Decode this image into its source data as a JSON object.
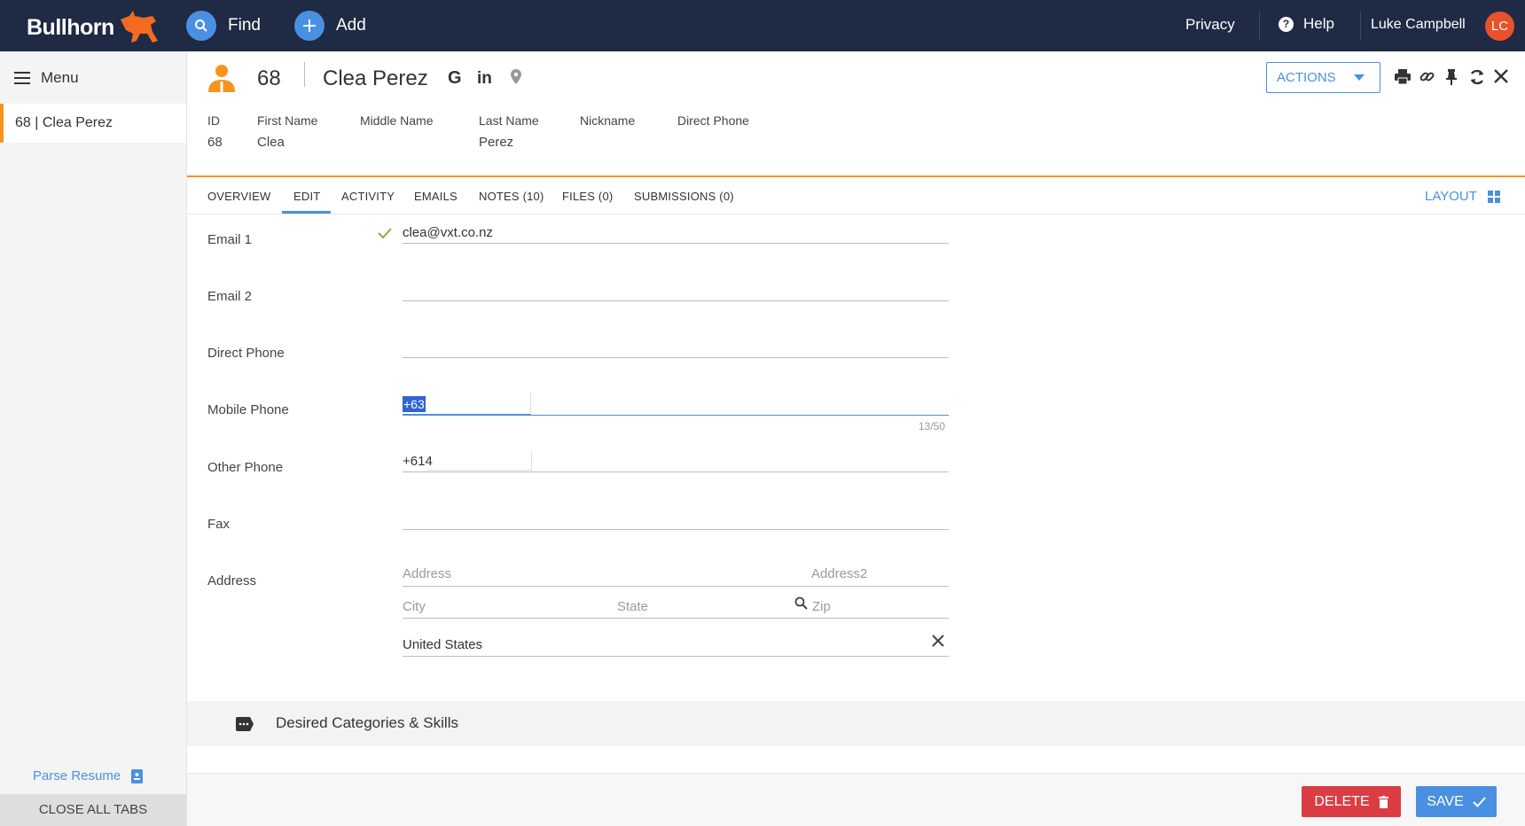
{
  "topbar": {
    "logo": "Bullhorn",
    "find_label": "Find",
    "add_label": "Add",
    "privacy_label": "Privacy",
    "help_label": "Help",
    "user_name": "Luke Campbell",
    "avatar_initials": "LC"
  },
  "sidebar": {
    "menu_label": "Menu",
    "open_tab": "68 | Clea Perez",
    "parse_resume_label": "Parse Resume",
    "close_all_label": "CLOSE ALL TABS"
  },
  "record": {
    "id": "68",
    "name": "Clea Perez",
    "google_icon": "G",
    "linkedin_icon": "in",
    "actions_label": "ACTIONS",
    "fields": [
      {
        "label": "ID",
        "value": "68"
      },
      {
        "label": "First Name",
        "value": "Clea"
      },
      {
        "label": "Middle Name",
        "value": ""
      },
      {
        "label": "Last Name",
        "value": "Perez"
      },
      {
        "label": "Nickname",
        "value": ""
      },
      {
        "label": "Direct Phone",
        "value": ""
      }
    ]
  },
  "tabs": [
    {
      "label": "OVERVIEW"
    },
    {
      "label": "EDIT"
    },
    {
      "label": "ACTIVITY"
    },
    {
      "label": "EMAILS"
    },
    {
      "label": "NOTES (10)"
    },
    {
      "label": "FILES (0)"
    },
    {
      "label": "SUBMISSIONS (0)"
    }
  ],
  "layout_label": "LAYOUT",
  "form": {
    "email1": {
      "label": "Email 1",
      "value": "clea@vxt.co.nz"
    },
    "email2": {
      "label": "Email 2",
      "value": ""
    },
    "direct_phone": {
      "label": "Direct Phone",
      "value": ""
    },
    "mobile_phone": {
      "label": "Mobile Phone",
      "value": "+63",
      "counter": "13/50"
    },
    "other_phone": {
      "label": "Other Phone",
      "value": "+614"
    },
    "fax": {
      "label": "Fax",
      "value": ""
    },
    "address": {
      "label": "Address",
      "address_placeholder": "Address",
      "address2_placeholder": "Address2",
      "city_placeholder": "City",
      "state_placeholder": "State",
      "zip_placeholder": "Zip",
      "country": "United States"
    }
  },
  "section": {
    "title": "Desired Categories & Skills"
  },
  "footer": {
    "delete_label": "DELETE",
    "save_label": "SAVE"
  },
  "colors": {
    "navy": "#1f2a44",
    "orange": "#f7941d",
    "blue": "#4a90e2",
    "red": "#da3d44"
  }
}
